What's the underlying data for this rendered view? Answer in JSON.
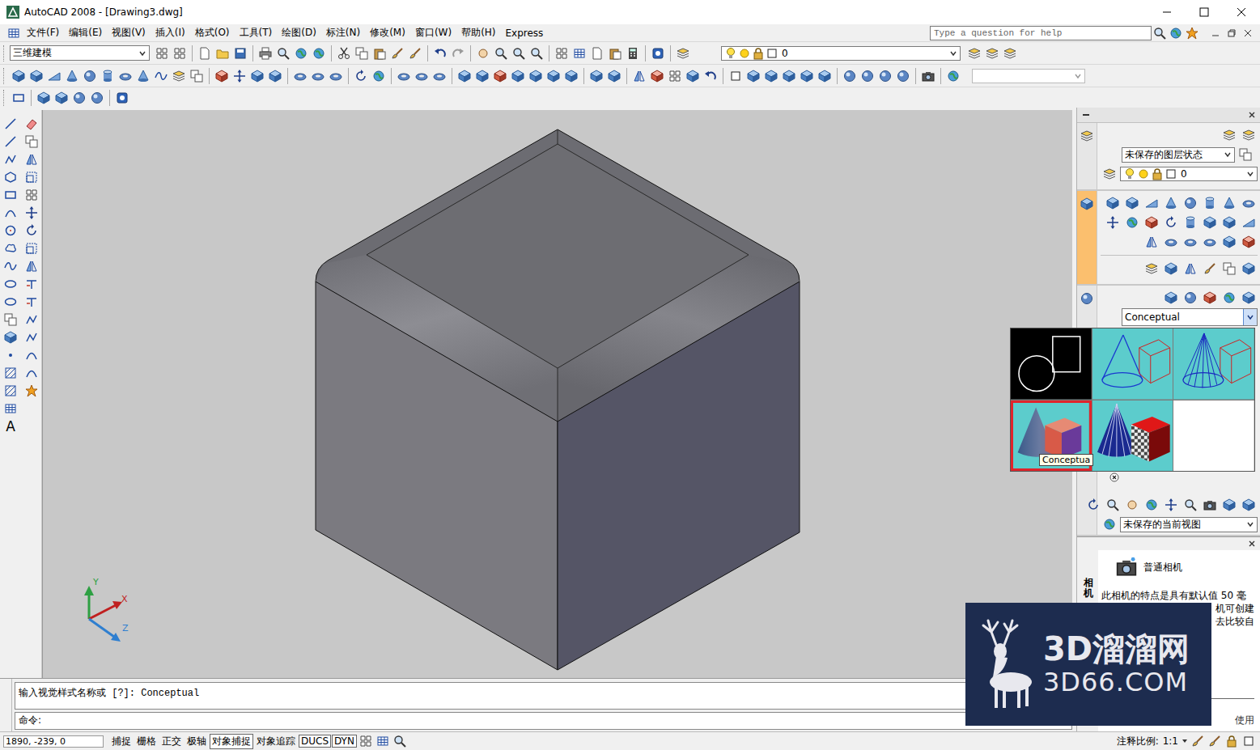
{
  "window": {
    "title": "AutoCAD 2008 - [Drawing3.dwg]"
  },
  "menu": [
    "文件(F)",
    "编辑(E)",
    "视图(V)",
    "插入(I)",
    "格式(O)",
    "工具(T)",
    "绘图(D)",
    "标注(N)",
    "修改(M)",
    "窗口(W)",
    "帮助(H)",
    "Express"
  ],
  "help_search": {
    "placeholder": "Type a question for help"
  },
  "toolbar": {
    "workspace": "三维建模",
    "layer": "0",
    "style_field": ""
  },
  "left_tools": {
    "text_tool": "A"
  },
  "ucs": {
    "x": "X",
    "y": "Y",
    "z": "Z"
  },
  "dashboard": {
    "layer_state": "未保存的图层状态",
    "layer": "0",
    "visual_style": "Conceptual",
    "swatches": [
      {
        "kind": "wire2d",
        "selected": false
      },
      {
        "kind": "wire3d",
        "selected": false
      },
      {
        "kind": "hidden",
        "selected": false
      },
      {
        "kind": "conceptual",
        "selected": true
      },
      {
        "kind": "realistic",
        "selected": false
      },
      {
        "kind": "empty",
        "selected": false
      }
    ],
    "tooltip": "Conceptua",
    "view": "未保存的当前视图",
    "camera": {
      "title": "相机",
      "name": "普通相机",
      "lines": [
        "此相机的特点是具有默认值 50 毫",
        "机可创建",
        "去比较自"
      ],
      "more": "使用"
    }
  },
  "command": {
    "lines": [
      "输入视觉样式名称或 [?]: Conceptual",
      "命令:"
    ]
  },
  "status_bar": {
    "coords": "1890, -239, 0",
    "toggles": [
      {
        "label": "捕捉",
        "on": false
      },
      {
        "label": "栅格",
        "on": false
      },
      {
        "label": "正交",
        "on": false
      },
      {
        "label": "极轴",
        "on": false
      },
      {
        "label": "对象捕捉",
        "on": true
      },
      {
        "label": "对象追踪",
        "on": false
      },
      {
        "label": "DUCS",
        "on": true
      },
      {
        "label": "DYN",
        "on": true
      }
    ],
    "scale_label": "注释比例:",
    "scale": "1:1"
  },
  "watermark": {
    "brand": "3D溜溜网",
    "url": "3D66.COM"
  }
}
